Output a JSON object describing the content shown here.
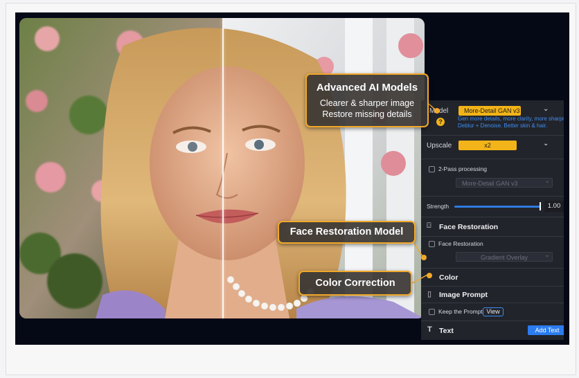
{
  "callouts": {
    "ai_models": {
      "title": "Advanced AI Models",
      "line1": "Clearer & sharper image",
      "line2": "Restore missing details"
    },
    "face": "Face Restoration Model",
    "color": "Color Correction"
  },
  "panel": {
    "model_label": "Model",
    "model_value": "More-Detail GAN  v3",
    "model_hint_line1": "Gen more details, more clarity, more sharpness",
    "model_hint_line2": "Deblur + Denoise. Better skin & hair.",
    "upscale_label": "Upscale",
    "upscale_value": "x2",
    "two_pass_label": "2-Pass processing",
    "two_pass_model": "More-Detail GAN  v3",
    "strength_label": "Strength",
    "strength_value": "1.00",
    "face_section": "Face Restoration",
    "face_checkbox_label": "Face Restoration",
    "face_model": "Gradient Overlay",
    "color_section": "Color",
    "image_prompt_section": "Image Prompt",
    "keep_prompt_label": "Keep the Prompt",
    "view_button": "View",
    "text_section": "Text",
    "add_text_button": "Add Text"
  },
  "colors": {
    "accent": "#f2a92a",
    "selected_dropdown": "#f2b418",
    "link_blue": "#3d8ef2",
    "panel_bg": "#22242b"
  }
}
